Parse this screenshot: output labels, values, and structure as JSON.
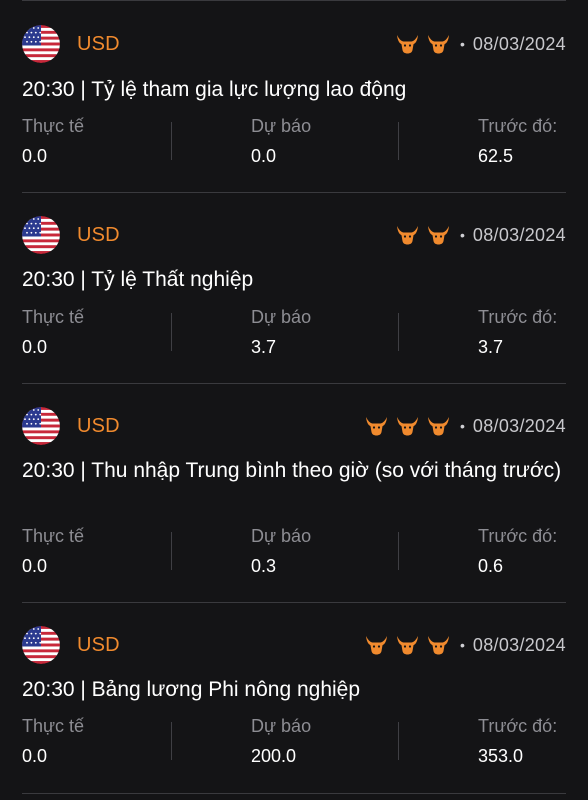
{
  "colors": {
    "background": "#141416",
    "accent": "#f08a2e",
    "muted": "#8d8d93"
  },
  "labels": {
    "actual": "Thực tế",
    "forecast": "Dự báo",
    "previous": "Trước đó:"
  },
  "events": [
    {
      "currency": "USD",
      "flag": "us-flag-icon",
      "importance": 2,
      "bull_icon": "bull-icon",
      "date": "08/03/2024",
      "title": "20:30 | Tỷ lệ tham gia lực lượng lao động",
      "actual": "0.0",
      "forecast": "0.0",
      "previous": "62.5"
    },
    {
      "currency": "USD",
      "flag": "us-flag-icon",
      "importance": 2,
      "bull_icon": "bull-icon",
      "date": "08/03/2024",
      "title": "20:30 | Tỷ lệ Thất nghiệp",
      "actual": "0.0",
      "forecast": "3.7",
      "previous": "3.7"
    },
    {
      "currency": "USD",
      "flag": "us-flag-icon",
      "importance": 3,
      "bull_icon": "bull-icon",
      "date": "08/03/2024",
      "title": "20:30 | Thu nhập Trung bình theo giờ (so với tháng trước)",
      "actual": "0.0",
      "forecast": "0.3",
      "previous": "0.6"
    },
    {
      "currency": "USD",
      "flag": "us-flag-icon",
      "importance": 3,
      "bull_icon": "bull-icon",
      "date": "08/03/2024",
      "title": "20:30 | Bảng lương Phi nông nghiệp",
      "actual": "0.0",
      "forecast": "200.0",
      "previous": "353.0"
    }
  ]
}
